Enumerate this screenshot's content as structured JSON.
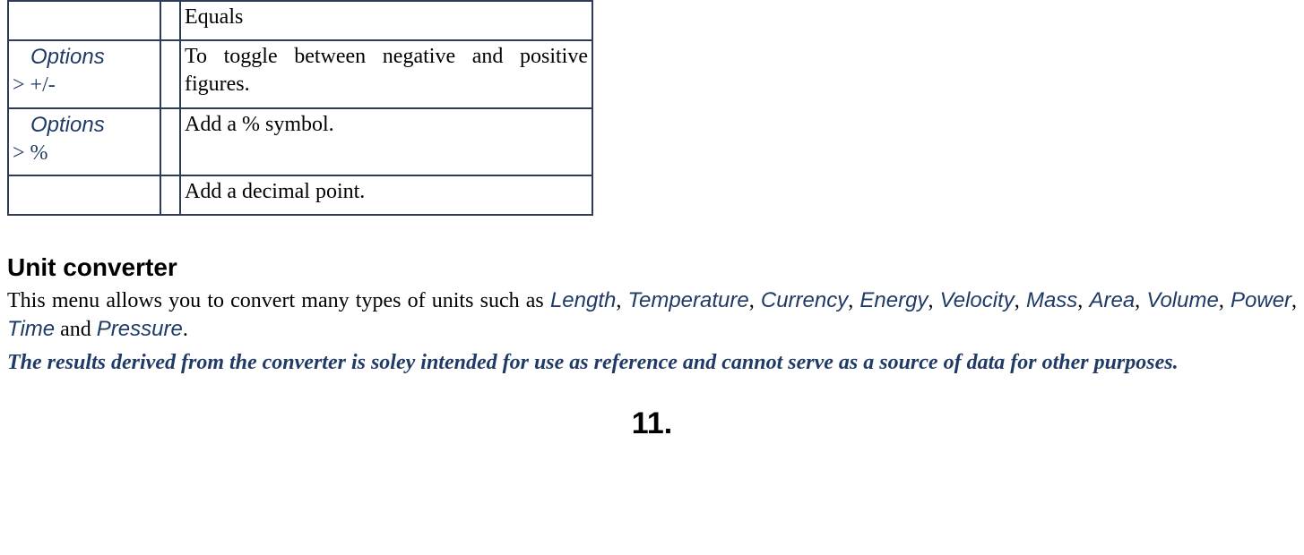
{
  "table": {
    "rows": [
      {
        "opt_word": "",
        "gt": "",
        "suffix": "",
        "spacer": "",
        "desc": "Equals"
      },
      {
        "opt_word": "Options",
        "gt": "> ",
        "suffix": "+/-",
        "spacer": "",
        "desc": "To toggle between negative and positive figures."
      },
      {
        "opt_word": "Options",
        "gt": "> ",
        "suffix": "%",
        "spacer": "",
        "desc": "Add a % symbol."
      },
      {
        "opt_word": "",
        "gt": "",
        "suffix": "",
        "spacer": "",
        "desc": "Add a decimal point."
      }
    ]
  },
  "section": {
    "title": "Unit converter",
    "body_pre": "This menu allows you to convert many types of units such as ",
    "units": {
      "u1": "Length",
      "u2": "Temperature",
      "u3": "Currency",
      "u4": "Energy",
      "u5": "Velocity",
      "u6": "Mass",
      "u7": "Area",
      "u8": "Volume",
      "u9": "Power",
      "u10": "Time",
      "u11": "Pressure"
    },
    "sep_comma": ", ",
    "sep_and": " and ",
    "body_post": ".",
    "note": "The results derived from the converter is soley intended for use as reference and cannot serve as a source of data for other purposes."
  },
  "page_number": "11."
}
